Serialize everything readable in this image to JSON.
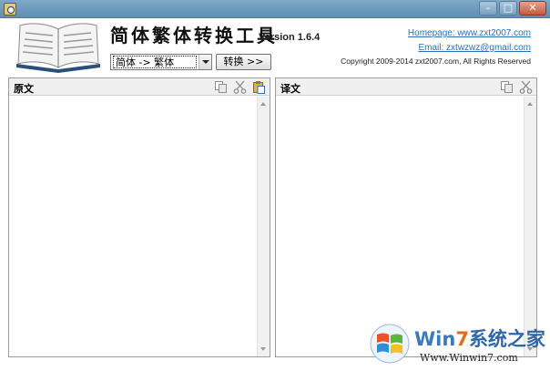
{
  "window": {
    "controls": [
      "–",
      "□",
      "✕"
    ]
  },
  "header": {
    "title": "简体繁体转换工具",
    "version": "Version 1.6.4",
    "direction_select": {
      "value": "简体 -> 繁体"
    },
    "convert_label": "转换 >>",
    "homepage": "Homepage: www.zxt2007.com",
    "email": "Email: zxtwzwz@gmail.com",
    "copyright": "Copyright 2009-2014 zxt2007.com, All Rights Reserved"
  },
  "source_panel": {
    "title": "原文",
    "text": "",
    "tools": [
      "copy-icon",
      "cut-icon",
      "paste-icon"
    ]
  },
  "target_panel": {
    "title": "译文",
    "text": "",
    "tools": [
      "copy-icon",
      "cut-icon"
    ]
  },
  "watermark": {
    "brand_prefix": "Win",
    "brand_number": "7",
    "brand_suffix": "系统之家",
    "url": "Www.Winwin7.com"
  },
  "colors": {
    "titlebar": "#6d9cbf",
    "link": "#2a6fb5",
    "panel_header": "#f0f0f0",
    "watermark_orange": "#e36a1e",
    "watermark_blue": "#3d7ab8"
  }
}
